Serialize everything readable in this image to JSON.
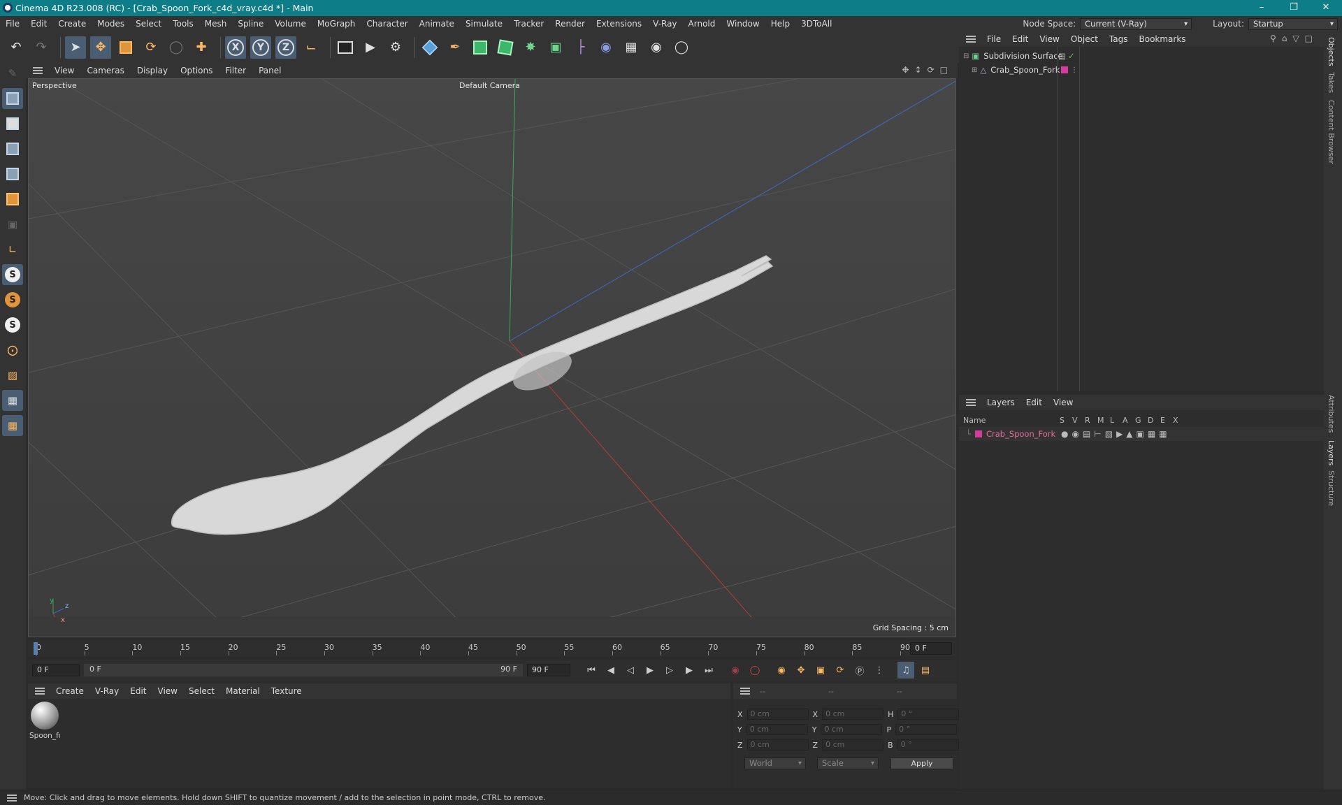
{
  "title": "Cinema 4D R23.008 (RC) - [Crab_Spoon_Fork_c4d_vray.c4d *] - Main",
  "window_controls": [
    "–",
    "❐",
    "✕"
  ],
  "menu": [
    "File",
    "Edit",
    "Create",
    "Modes",
    "Select",
    "Tools",
    "Mesh",
    "Spline",
    "Volume",
    "MoGraph",
    "Character",
    "Animate",
    "Simulate",
    "Tracker",
    "Render",
    "Extensions",
    "V-Ray",
    "Arnold",
    "Window",
    "Help",
    "3DToAll"
  ],
  "node_space": {
    "label": "Node Space:",
    "value": "Current (V-Ray)"
  },
  "layout": {
    "label": "Layout:",
    "value": "Startup"
  },
  "viewport_menu": [
    "View",
    "Cameras",
    "Display",
    "Options",
    "Filter",
    "Panel"
  ],
  "viewport": {
    "name": "Perspective",
    "camera": "Default Camera",
    "grid_spacing": "Grid Spacing : 5 cm",
    "axis_y": "y",
    "axis_z": "z",
    "axis_x": "x"
  },
  "timeline": {
    "ticks": [
      "0",
      "5",
      "10",
      "15",
      "20",
      "25",
      "30",
      "35",
      "40",
      "45",
      "50",
      "55",
      "60",
      "65",
      "70",
      "75",
      "80",
      "85",
      "90"
    ],
    "current_frame": "0 F"
  },
  "transport": {
    "start": "0 F",
    "range_start": "0 F",
    "range_end": "90 F",
    "end": "90 F"
  },
  "objects_menu": [
    "File",
    "Edit",
    "View",
    "Object",
    "Tags",
    "Bookmarks"
  ],
  "objects": [
    {
      "name": "Subdivision Surface"
    },
    {
      "name": "Crab_Spoon_Fork",
      "color": "#d63ca0"
    }
  ],
  "layers_menu": [
    "Layers",
    "Edit",
    "View"
  ],
  "layers_header": {
    "name": "Name",
    "cols": [
      "S",
      "V",
      "R",
      "M",
      "L",
      "A",
      "G",
      "D",
      "E",
      "X"
    ]
  },
  "layers": [
    {
      "name": "Crab_Spoon_Fork",
      "color": "#d63ca0"
    }
  ],
  "right_tabs": [
    "Objects",
    "Takes",
    "Content Browser",
    "Attributes",
    "Layers",
    "Structure"
  ],
  "material_menu": [
    "Create",
    "V-Ray",
    "Edit",
    "View",
    "Select",
    "Material",
    "Texture"
  ],
  "materials": [
    {
      "name": "Spoon_fo"
    }
  ],
  "coords": {
    "header": [
      "--",
      "--",
      "--"
    ],
    "rows": [
      {
        "a": "X",
        "v1": "0 cm",
        "b": "X",
        "v2": "0 cm",
        "c": "H",
        "v3": "0 °"
      },
      {
        "a": "Y",
        "v1": "0 cm",
        "b": "Y",
        "v2": "0 cm",
        "c": "P",
        "v3": "0 °"
      },
      {
        "a": "Z",
        "v1": "0 cm",
        "b": "Z",
        "v2": "0 cm",
        "c": "B",
        "v3": "0 °"
      }
    ],
    "mode1": "World",
    "mode2": "Scale",
    "apply": "Apply"
  },
  "status": "Move: Click and drag to move elements. Hold down SHIFT to quantize movement / add to the selection in point mode, CTRL to remove.",
  "accent_color": "#0d7d87"
}
